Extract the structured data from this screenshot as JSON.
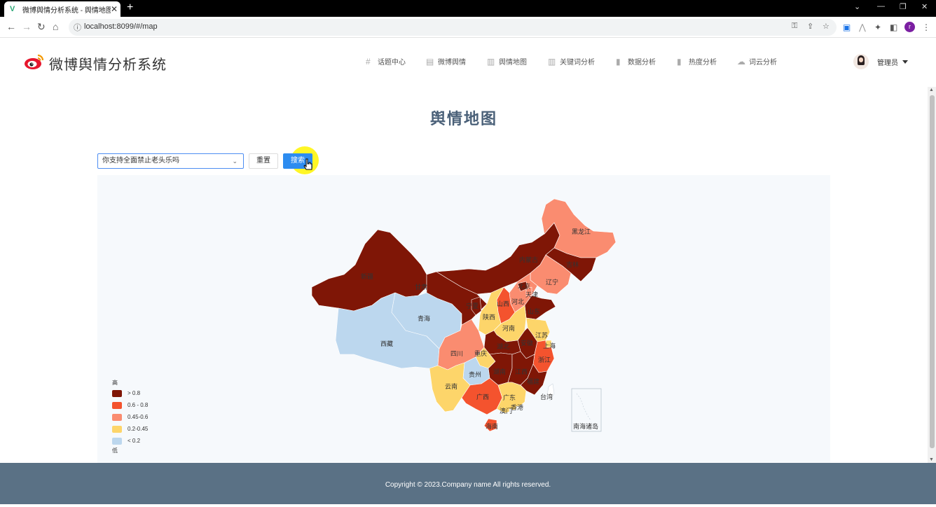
{
  "browser": {
    "tab_title": "微博舆情分析系统 - 舆情地图",
    "url": "localhost:8099/#/map",
    "profile_initial": "r"
  },
  "header": {
    "brand": "微博舆情分析系统",
    "menu": [
      {
        "icon": "hash-icon",
        "label": "话题中心"
      },
      {
        "icon": "document-icon",
        "label": "微博舆情"
      },
      {
        "icon": "building-icon",
        "label": "舆情地图"
      },
      {
        "icon": "building-icon",
        "label": "关键词分析"
      },
      {
        "icon": "bar-chart-icon",
        "label": "数据分析"
      },
      {
        "icon": "bar-chart-icon",
        "label": "热度分析"
      },
      {
        "icon": "cloud-icon",
        "label": "词云分析"
      }
    ],
    "user": "管理员"
  },
  "main": {
    "title": "舆情地图",
    "topic_select_value": "你支持全面禁止老头乐吗",
    "reset_label": "重置",
    "search_label": "搜索"
  },
  "map": {
    "legend_high": "高",
    "legend_low": "低",
    "legend": [
      {
        "label": "> 0.8",
        "color": "#7f1606"
      },
      {
        "label": "0.6 - 0.8",
        "color": "#f4532e"
      },
      {
        "label": "0.45-0.6",
        "color": "#fa8c70"
      },
      {
        "label": "0.2-0.45",
        "color": "#fdd56a"
      },
      {
        "label": "< 0.2",
        "color": "#bcd7ee"
      }
    ],
    "provinces": {
      "xinjiang": "新疆",
      "xizang": "西藏",
      "qinghai": "青海",
      "gansu": "甘肃",
      "neimenggu": "内蒙古",
      "heilongjiang": "黑龙江",
      "jilin": "吉林",
      "liaoning": "辽宁",
      "beijing": "北京",
      "tianjin": "天津",
      "hebei": "河北",
      "shanxi": "山西",
      "shandong": "山东",
      "henan": "河南",
      "shaanxi": "陕西",
      "ningxia": "宁夏",
      "sichuan": "四川",
      "chongqing": "重庆",
      "hubei": "湖北",
      "anhui": "安徽",
      "jiangsu": "江苏",
      "shanghai": "上海",
      "zhejiang": "浙江",
      "hunan": "湖南",
      "jiangxi": "江西",
      "fujian": "福建",
      "guizhou": "贵州",
      "yunnan": "云南",
      "guangxi": "广西",
      "guangdong": "广东",
      "hainan": "海南",
      "taiwan": "台湾",
      "hongkong": "香港",
      "macau": "澳门",
      "south_china_sea": "南海诸岛"
    }
  },
  "footer": {
    "copyright": "Copyright © 2023.Company name All rights reserved."
  }
}
